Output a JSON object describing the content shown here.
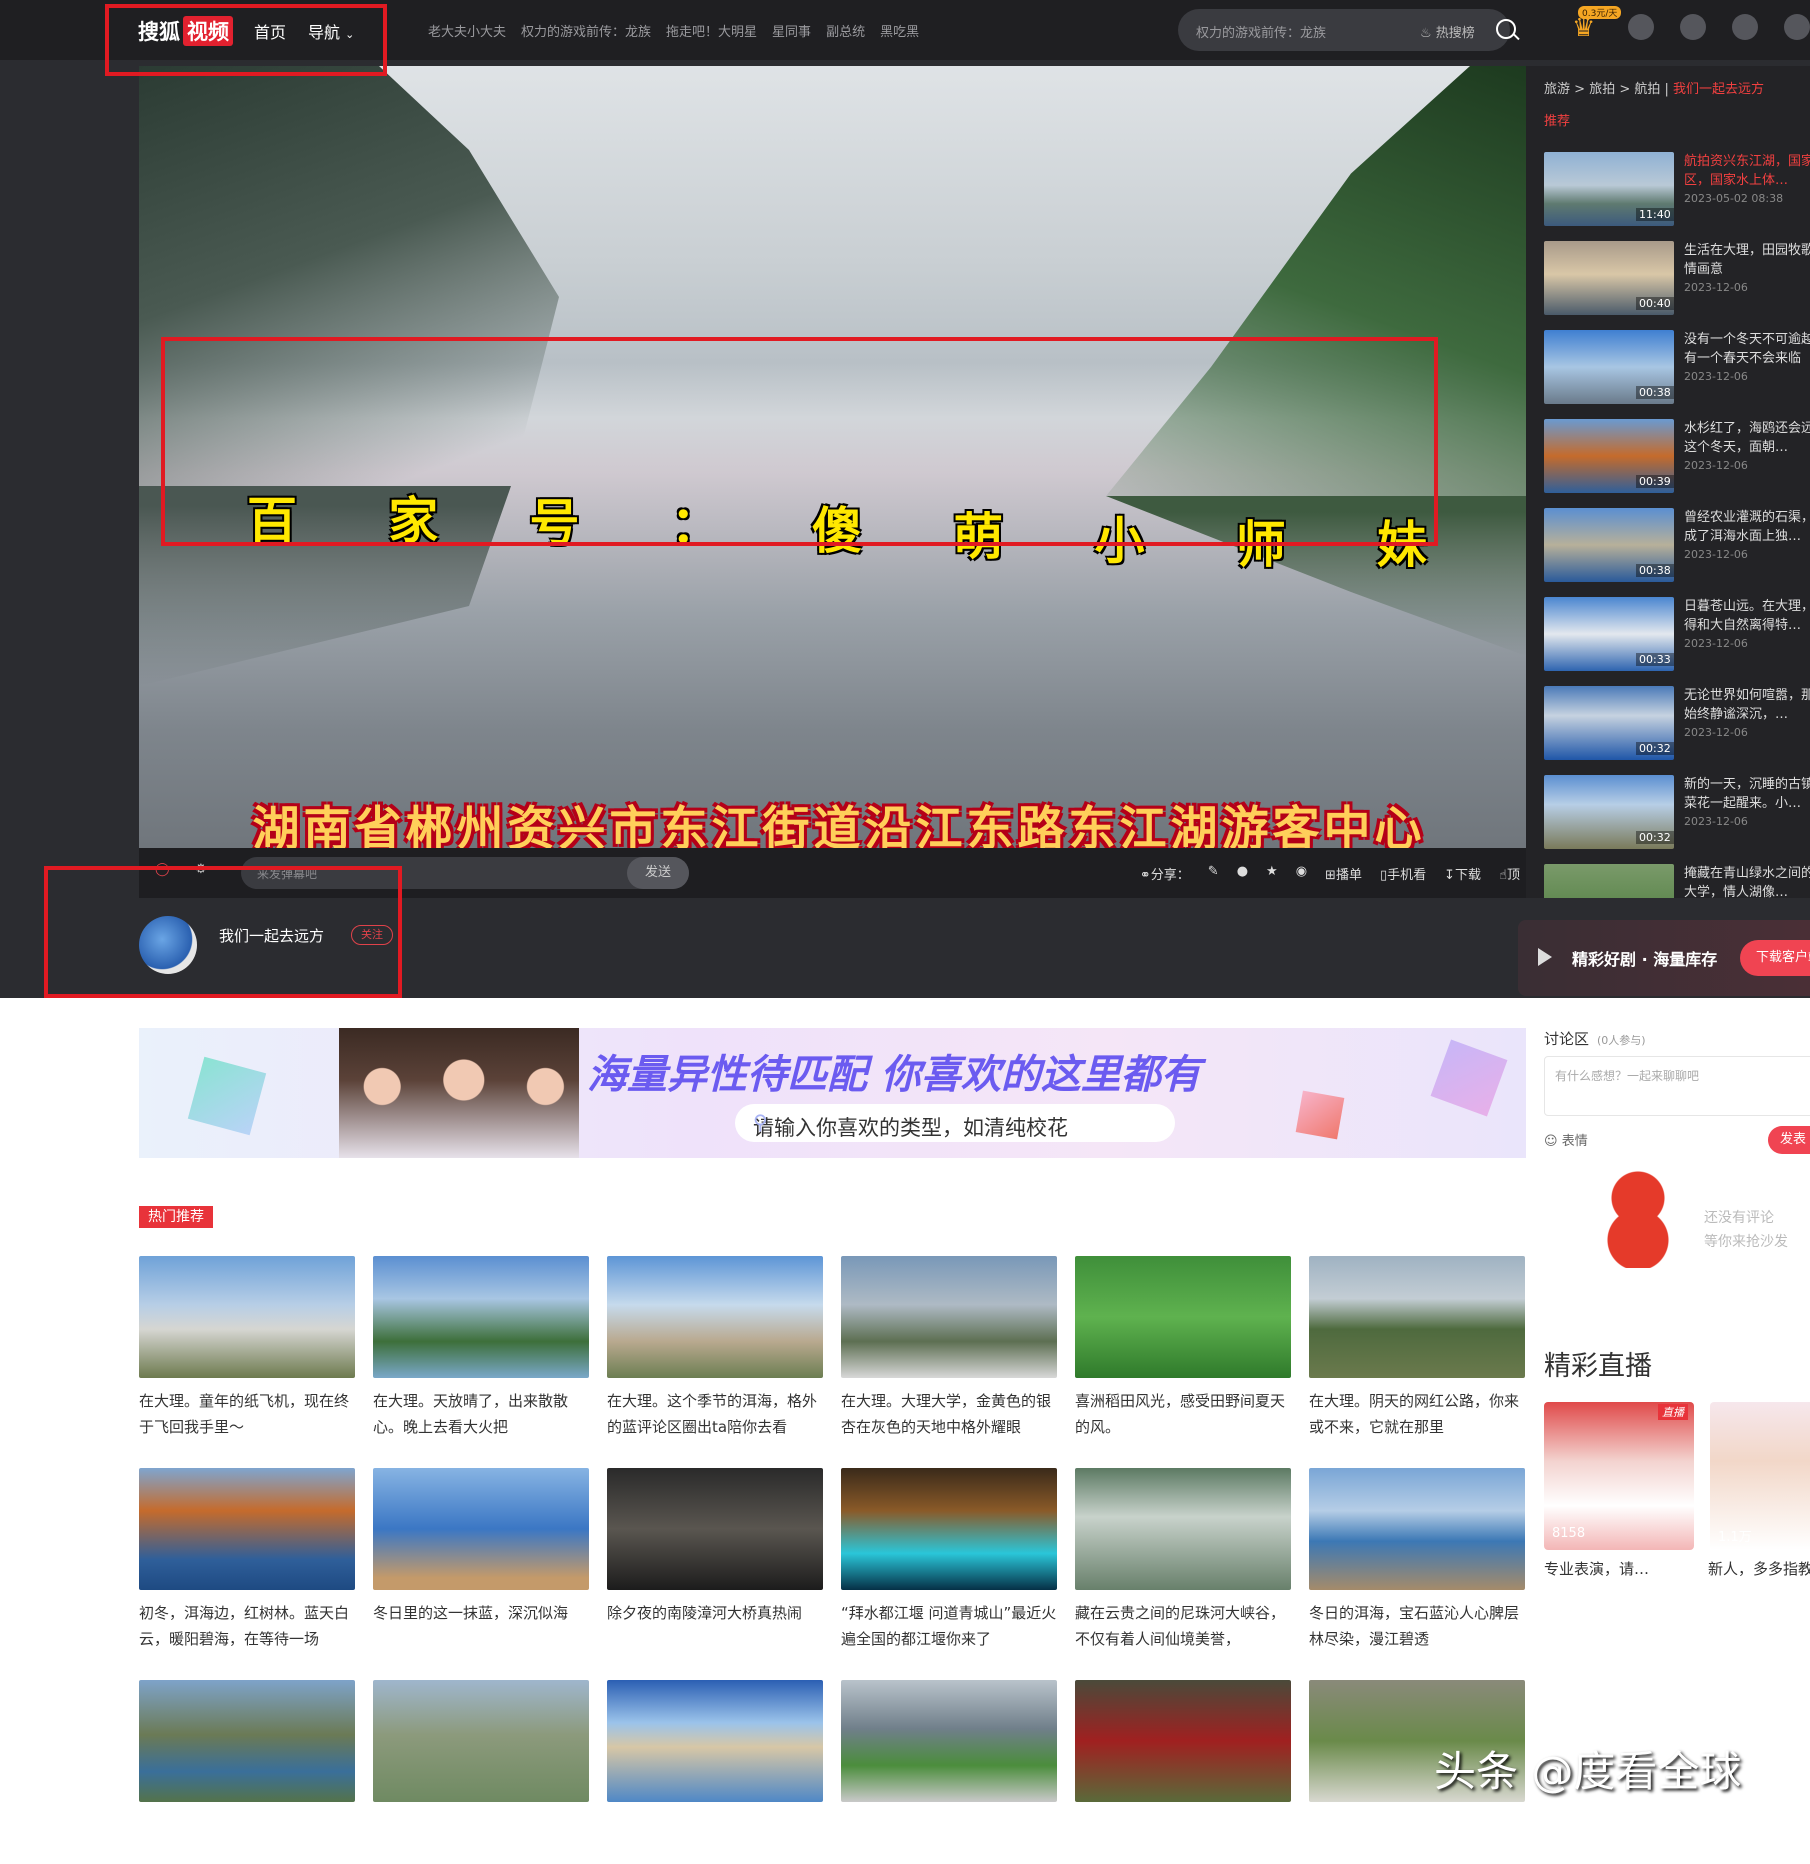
{
  "header": {
    "logo_text": "搜狐",
    "logo_badge": "视频",
    "nav_home": "首页",
    "nav_guide": "导航",
    "hot_links": [
      "老大夫小大夫",
      "权力的游戏前传：龙族",
      "拖走吧！大明星",
      "星同事",
      "副总统",
      "黑吃黑"
    ],
    "search_placeholder": "权力的游戏前传：龙族",
    "hot_search": "热搜榜",
    "vip_badge": "0.3元/天"
  },
  "player": {
    "watermark_chars": [
      "百",
      "家",
      "号",
      "：",
      "傻",
      "萌",
      "小",
      "师",
      "妹"
    ],
    "subtitle": "湖南省郴州资兴市东江街道沿江东路东江湖游客中心",
    "danmu_placeholder": "来发弹幕吧",
    "send_label": "发送",
    "share_label": "分享：",
    "playlist_label": "播单",
    "mobile_label": "手机看",
    "download_label": "下载",
    "like_label": "顶"
  },
  "sidebar": {
    "breadcrumb": [
      "旅游",
      "旅拍",
      "航拍"
    ],
    "channel": "我们一起去远方",
    "tab": "推荐",
    "items": [
      {
        "title": "航拍资兴东江湖，国家级景区，国家水上体…",
        "date": "2023-05-02 08:38",
        "duration": "11:40",
        "active": true
      },
      {
        "title": "生活在大理，田园牧歌，诗情画意",
        "date": "2023-12-06",
        "duration": "00:40"
      },
      {
        "title": "没有一个冬天不可逾越，没有一个春天不会来临",
        "date": "2023-12-06",
        "duration": "00:38"
      },
      {
        "title": "水杉红了，海鸥还会远吗？这个冬天，面朝…",
        "date": "2023-12-06",
        "duration": "00:39"
      },
      {
        "title": "曾经农业灌溉的石渠，如今成了洱海水面上独…",
        "date": "2023-12-06",
        "duration": "00:38"
      },
      {
        "title": "日暮苍山远。在大理，总觉得和大自然离得特…",
        "date": "2023-12-06",
        "duration": "00:33"
      },
      {
        "title": "无论世界如何喧嚣，那抹蓝始终静谧深沉，…",
        "date": "2023-12-06",
        "duration": "00:32"
      },
      {
        "title": "新的一天，沉睡的古镇和油菜花一起醒来。小…",
        "date": "2023-12-06",
        "duration": "00:32"
      },
      {
        "title": "掩藏在青山绿水之间的大理大学，情人湖像…",
        "date": "",
        "duration": ""
      }
    ]
  },
  "author": {
    "name": "我们一起去远方",
    "follow": "关注"
  },
  "promo": {
    "text": "精彩好剧 · 海量库存",
    "button": "下载客户端"
  },
  "banner": {
    "title": "海量异性待匹配 你喜欢的这里都有",
    "search_text": "请输入你喜欢的类型，如清纯校花"
  },
  "discussion": {
    "title": "讨论区",
    "count": "(0人参与)",
    "placeholder": "有什么感想？一起来聊聊吧",
    "emoji": "表情",
    "publish": "发表",
    "empty": [
      "还没有评论",
      "等你来抢沙发"
    ]
  },
  "hot": {
    "tag": "热门推荐",
    "cards": [
      "在大理。童年的纸飞机，现在终于飞回我手里～",
      "在大理。天放晴了，出来散散心。晚上去看大火把",
      "在大理。这个季节的洱海，格外的蓝评论区圈出ta陪你去看",
      "在大理。大理大学，金黄色的银杏在灰色的天地中格外耀眼",
      "喜洲稻田风光，感受田野间夏天的风。",
      "在大理。阴天的网红公路，你来或不来，它就在那里",
      "初冬，洱海边，红树林。蓝天白云，暖阳碧海，在等待一场",
      "冬日里的这一抹蓝，深沉似海",
      "除夕夜的南陵漳河大桥真热闹",
      "“拜水都江堰 问道青城山”最近火遍全国的都江堰你来了",
      "藏在云贵之间的尼珠河大峡谷，不仅有着人间仙境美誉，",
      "冬日的洱海，宝石蓝沁人心脾层林尽染，漫江碧透",
      "",
      "",
      "",
      "",
      "",
      ""
    ]
  },
  "live": {
    "title": "精彩直播",
    "badge": "直播",
    "items": [
      {
        "viewers": "8158",
        "caption": "专业表演，请…"
      },
      {
        "viewers": "1.1万",
        "caption": "新人，多多指教"
      }
    ]
  },
  "watermark": "头条 @度看全球"
}
